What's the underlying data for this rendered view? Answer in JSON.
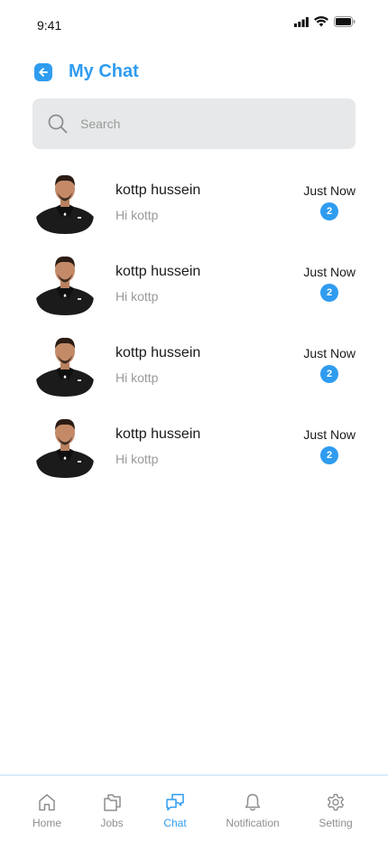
{
  "status_bar": {
    "time": "9:41",
    "icons": [
      "signal-icon",
      "wifi-icon",
      "battery-icon"
    ]
  },
  "header": {
    "back_icon": "arrow-left-icon",
    "title": "My Chat"
  },
  "search": {
    "icon": "search-icon",
    "placeholder": "Search",
    "value": ""
  },
  "chats": [
    {
      "name": "kottp hussein",
      "preview": "Hi kottp",
      "time": "Just Now",
      "unread": "2"
    },
    {
      "name": "kottp hussein",
      "preview": "Hi kottp",
      "time": "Just Now",
      "unread": "2"
    },
    {
      "name": "kottp hussein",
      "preview": "Hi kottp",
      "time": "Just Now",
      "unread": "2"
    },
    {
      "name": "kottp hussein",
      "preview": "Hi kottp",
      "time": "Just Now",
      "unread": "2"
    }
  ],
  "bottom_nav": {
    "items": [
      {
        "label": "Home",
        "icon": "home-icon",
        "active": false
      },
      {
        "label": "Jobs",
        "icon": "folders-icon",
        "active": false
      },
      {
        "label": "Chat",
        "icon": "chat-icon",
        "active": true
      },
      {
        "label": "Notification",
        "icon": "bell-icon",
        "active": false
      },
      {
        "label": "Setting",
        "icon": "gear-icon",
        "active": false
      }
    ]
  },
  "colors": {
    "accent": "#2f9cf0",
    "muted_text": "#9a9a9a",
    "search_bg": "#e6e8e9",
    "inactive_nav": "#8e8e8e"
  }
}
